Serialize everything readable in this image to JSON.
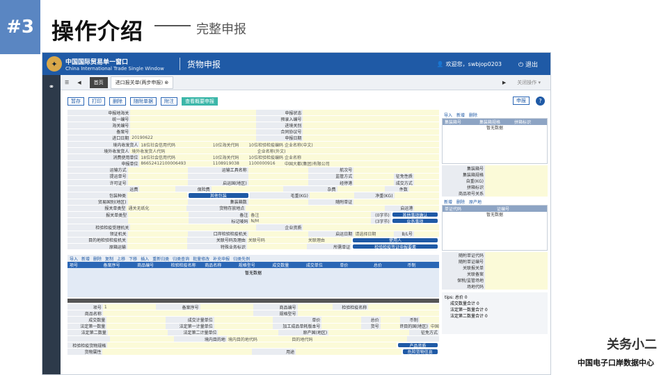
{
  "slide": {
    "badge": "#3",
    "title": "操作介绍",
    "dash": "——",
    "subtitle": "完整申报"
  },
  "header": {
    "brand_zh": "中国国际贸易单一窗口",
    "brand_en": "China International Trade Single Window",
    "module": "货物申报",
    "welcome": "欢迎您，swbjop0203",
    "logout": "退出"
  },
  "tabs": {
    "home": "首页",
    "active": "进口报关单(两步申报)",
    "close_ops": "关闭操作 ▾"
  },
  "toolbar": {
    "buttons": [
      "暂存",
      "打印",
      "删除",
      "随附单据",
      "附注",
      "查看概要申报"
    ],
    "declare": "申报",
    "help": "?"
  },
  "form": {
    "rows": [
      [
        [
          "lbl",
          "申报地海关",
          1.2
        ],
        [
          "val",
          "",
          2.4
        ],
        [
          "lbl",
          "申报状态",
          0.9
        ],
        [
          "val",
          "",
          2.6
        ]
      ],
      [
        [
          "lbl",
          "统一编号",
          1.2
        ],
        [
          "val",
          "",
          2.4
        ],
        [
          "lbl",
          "预录入编号",
          0.9
        ],
        [
          "val",
          "",
          2.6
        ]
      ],
      [
        [
          "lbl",
          "海关编号",
          1.2
        ],
        [
          "val",
          "",
          2.4
        ],
        [
          "lbl",
          "进境关别",
          0.9
        ],
        [
          "val",
          "",
          2.6
        ]
      ],
      [
        [
          "lbl",
          "备案号",
          1.2
        ],
        [
          "val",
          "",
          2.4
        ],
        [
          "lbl",
          "合同协议号",
          0.9
        ],
        [
          "val",
          "",
          2.6
        ]
      ],
      [
        [
          "lbl",
          "进口日期",
          1.2
        ],
        [
          "val",
          "20190622",
          2.4
        ],
        [
          "lbl",
          "申报日期",
          0.9
        ],
        [
          "val",
          "",
          2.6
        ]
      ],
      [
        [
          "lbl",
          "境内收发货人",
          1.2
        ],
        [
          "val",
          "18位社会信用代码",
          1.2
        ],
        [
          "val",
          "10位海关代码",
          0.6
        ],
        [
          "val",
          "10位检验检疫编码",
          0.6
        ],
        [
          "val",
          "企业名称(中文)",
          2.6
        ]
      ],
      [
        [
          "lbl",
          "境外收发货人",
          1.2
        ],
        [
          "val",
          "境外收发货人代码",
          2.4
        ],
        [
          "val",
          "企业名称(外文)",
          3.5
        ]
      ],
      [
        [
          "lbl",
          "消费使用单位",
          1.2
        ],
        [
          "val",
          "18位社会信用代码",
          1.2
        ],
        [
          "val",
          "10位海关代码",
          0.6
        ],
        [
          "val",
          "10位检验检疫编码",
          0.6
        ],
        [
          "val",
          "企业名称",
          2.6
        ]
      ],
      [
        [
          "lbl",
          "申报单位",
          1.2
        ],
        [
          "val",
          "86652412100006493",
          1.2
        ],
        [
          "val",
          "1108919038",
          0.6
        ],
        [
          "val",
          "1100000916",
          0.6
        ],
        [
          "val",
          "中国大都(集团)有限公司",
          2.6
        ]
      ],
      [
        [
          "lbl",
          "运输方式",
          1.2
        ],
        [
          "val",
          "",
          1.2
        ],
        [
          "lbl",
          "运输工具名称",
          1.2
        ],
        [
          "val",
          "",
          1.2
        ],
        [
          "lbl",
          "航次号",
          0.9
        ],
        [
          "val",
          "",
          1.7
        ]
      ],
      [
        [
          "lbl",
          "提运单号",
          1.2
        ],
        [
          "val",
          "",
          1.2
        ],
        [
          "lbl",
          "",
          1.2
        ],
        [
          "val",
          "",
          1.2
        ],
        [
          "lbl",
          "监管方式",
          0.9
        ],
        [
          "val",
          "",
          0.8
        ],
        [
          "lbl",
          "征免性质",
          0.4
        ],
        [
          "val",
          "",
          0.5
        ]
      ],
      [
        [
          "lbl",
          "许可证号",
          1.2
        ],
        [
          "val",
          "",
          1.2
        ],
        [
          "lbl",
          "启运国(地区)",
          1.2
        ],
        [
          "val",
          "",
          1.2
        ],
        [
          "lbl",
          "经停港",
          0.9
        ],
        [
          "val",
          "",
          0.8
        ],
        [
          "lbl",
          "成交方式",
          0.4
        ],
        [
          "val",
          "",
          0.5
        ]
      ],
      [
        [
          "lbl",
          "运费",
          1.2
        ],
        [
          "val",
          "",
          0.6
        ],
        [
          "lbl",
          "保险费",
          0.6
        ],
        [
          "val",
          "",
          1.2
        ],
        [
          "lbl",
          "杂费",
          0.9
        ],
        [
          "val",
          "",
          0.8
        ],
        [
          "lbl",
          "件数",
          0.4
        ],
        [
          "val",
          "",
          0.5
        ]
      ],
      [
        [
          "lbl",
          "包装种类",
          1.2
        ],
        [
          "val",
          "",
          1.2
        ],
        [
          "blueb",
          "其他包装",
          1.2
        ],
        [
          "lbl",
          "毛重(KG)",
          1.2
        ],
        [
          "val",
          "",
          0.9
        ],
        [
          "lbl",
          "净重(KG)",
          0.8
        ],
        [
          "val",
          "",
          0.9
        ]
      ],
      [
        [
          "lbl",
          "贸易国别(地区)",
          1.2
        ],
        [
          "val",
          "",
          1.2
        ],
        [
          "lbl",
          "集装箱数",
          1.2
        ],
        [
          "val",
          "",
          1.2
        ],
        [
          "lbl",
          "随附单证",
          0.9
        ],
        [
          "val",
          "",
          1.7
        ]
      ],
      [
        [
          "lbl",
          "报关单类型",
          1.2
        ],
        [
          "val",
          "通关无纸化",
          1.2
        ],
        [
          "lbl",
          "货物存放地点",
          1.2
        ],
        [
          "val",
          "",
          2.8
        ],
        [
          "lbl",
          "启运港",
          0.6
        ],
        [
          "val",
          "",
          0.5
        ]
      ],
      [
        [
          "lbl",
          "报关单类型",
          1.2
        ],
        [
          "val",
          "",
          1.2
        ],
        [
          "lbl",
          "备注",
          1.2
        ],
        [
          "val",
          "备注",
          2.4
        ],
        [
          "lbl",
          "(0字节)",
          0.4
        ],
        [
          "blueb",
          "其他事项确认",
          0.9
        ]
      ],
      [
        [
          "lbl",
          "",
          1.2
        ],
        [
          "val",
          "",
          1.2
        ],
        [
          "lbl",
          "标记唛码",
          1.2
        ],
        [
          "val",
          "N/M",
          2.4
        ],
        [
          "lbl",
          "(3字节)",
          0.4
        ],
        [
          "blueb",
          "业务事项",
          0.9
        ]
      ],
      [
        [
          "lbl",
          "检验检疫受理机关",
          1.2
        ],
        [
          "val",
          "",
          2.4
        ],
        [
          "lbl",
          "企业资质",
          0.9
        ],
        [
          "val",
          "",
          2.6
        ]
      ],
      [
        [
          "lbl",
          "领证机关",
          1.2
        ],
        [
          "val",
          "",
          1.2
        ],
        [
          "lbl",
          "口岸检验检疫机关",
          1.2
        ],
        [
          "val",
          "",
          1.2
        ],
        [
          "lbl",
          "启运日期",
          0.9
        ],
        [
          "val",
          "请选择日期",
          0.8
        ],
        [
          "lbl",
          "B/L号",
          0.4
        ],
        [
          "val",
          "",
          0.5
        ]
      ],
      [
        [
          "lbl",
          "目的地检验检疫机关",
          1.2
        ],
        [
          "val",
          "",
          1.2
        ],
        [
          "lbl",
          "关联号码及理由",
          1.2
        ],
        [
          "val",
          "关联号码",
          1.2
        ],
        [
          "val",
          "关联理由",
          0.9
        ],
        [
          "blueb",
          "使用人",
          1.7
        ]
      ],
      [
        [
          "lbl",
          "原箱运输",
          1.2
        ],
        [
          "val",
          "",
          1.2
        ],
        [
          "lbl",
          "特殊业务标识",
          1.2
        ],
        [
          "val",
          "",
          1.2
        ],
        [
          "lbl",
          "所需单证",
          0.9
        ],
        [
          "blueb",
          "检验检疫签证申报要素",
          1.7
        ]
      ]
    ]
  },
  "goods_bar": [
    "导入",
    "新增",
    "删除",
    "复制",
    "上移",
    "下移",
    "插入",
    "重新归类",
    "归类查询",
    "批量修改",
    "补充申报",
    "归类先例"
  ],
  "goods_columns": [
    "项号",
    "备案序号",
    "商品编号",
    "检验检疫名称",
    "商品名称",
    "规格型号",
    "成交数量",
    "成交单位",
    "单价",
    "总价",
    "币制"
  ],
  "goods_empty": "暂无数据",
  "bottom": {
    "rows": [
      [
        [
          "lbl",
          "项号",
          0.8
        ],
        [
          "val",
          "1",
          1.2
        ],
        [
          "lbl",
          "备案序号",
          1.0
        ],
        [
          "val",
          "",
          1.2
        ],
        [
          "lbl",
          "商品编号",
          1.0
        ],
        [
          "val",
          "",
          0.8
        ],
        [
          "lbl",
          "检验检疫名称",
          0.8
        ],
        [
          "val",
          "",
          1.6
        ]
      ],
      [
        [
          "lbl",
          "商品名称",
          0.8
        ],
        [
          "val",
          "",
          3.4
        ],
        [
          "lbl",
          "规格型号",
          1.0
        ],
        [
          "val",
          "",
          3.2
        ]
      ],
      [
        [
          "lbl",
          "成交数量",
          0.8
        ],
        [
          "val",
          "",
          1.2
        ],
        [
          "lbl",
          "成交计量单位",
          1.0
        ],
        [
          "val",
          "",
          1.2
        ],
        [
          "lbl",
          "单价",
          1.0
        ],
        [
          "val",
          "",
          0.8
        ],
        [
          "lbl",
          "总价",
          0.4
        ],
        [
          "val",
          "",
          0.4
        ],
        [
          "lbl",
          "币制",
          0.4
        ],
        [
          "val",
          "",
          0.4
        ]
      ],
      [
        [
          "lbl",
          "法定第一数量",
          0.8
        ],
        [
          "val",
          "",
          1.2
        ],
        [
          "lbl",
          "法定第一计量单位",
          1.0
        ],
        [
          "val",
          "",
          1.2
        ],
        [
          "lbl",
          "加工成品单耗版本号",
          1.0
        ],
        [
          "val",
          "",
          0.8
        ],
        [
          "lbl",
          "货号",
          0.4
        ],
        [
          "val",
          "",
          0.4
        ],
        [
          "lbl",
          "最终目的国(地区)",
          0.6
        ],
        [
          "val",
          "中国",
          0.2
        ]
      ],
      [
        [
          "lbl",
          "法定第二数量",
          0.8
        ],
        [
          "val",
          "",
          1.2
        ],
        [
          "lbl",
          "法定第二计量单位",
          1.0
        ],
        [
          "val",
          "",
          1.2
        ],
        [
          "lbl",
          "原产国(地区)",
          1.0
        ],
        [
          "val",
          "",
          1.6
        ],
        [
          "lbl",
          "征免方式",
          0.6
        ]
      ],
      [
        [
          "lbl",
          "",
          0.8
        ],
        [
          "val",
          "",
          1.2
        ],
        [
          "lbl",
          "境内目的地",
          1.0
        ],
        [
          "val",
          "境内目的地代码",
          1.2
        ],
        [
          "val",
          "目的地代码",
          2.2
        ],
        [
          "lbl",
          "",
          0.6
        ]
      ],
      [
        [
          "lbl",
          "检验检疫货物规格",
          0.8
        ],
        [
          "val",
          "",
          5.8
        ],
        [
          "blueb",
          "产品资质",
          0.8
        ]
      ],
      [
        [
          "lbl",
          "货物属性",
          0.8
        ],
        [
          "val",
          "",
          3.4
        ],
        [
          "lbl",
          "用途",
          1.0
        ],
        [
          "val",
          "",
          2.4
        ],
        [
          "blueb",
          "危险货物信息",
          0.8
        ]
      ]
    ]
  },
  "right": {
    "top_bar": [
      "导入",
      "新增",
      "删除"
    ],
    "top_cols": [
      "集装箱号",
      "集装箱规格",
      "拼箱标识"
    ],
    "empty": "暂无数据",
    "fields1": [
      "集装箱号",
      "集装箱规格",
      "自重(KG)",
      "拼箱标识",
      "商品项号关系"
    ],
    "bar2": [
      "新增",
      "删除",
      "原产地"
    ],
    "cols2": [
      "单证代码",
      "证编号"
    ],
    "empty2": "暂无数据",
    "fields2": [
      "随附单证代码",
      "随附单证编号",
      "关联报关单",
      "关联备案",
      "保税/监管场地",
      "场地代码"
    ],
    "tips": "tips: 总价 0",
    "sum": [
      "成交数量合计 0",
      "法定第一数量合计 0",
      "法定第二数量合计 0"
    ]
  },
  "watermark": {
    "brand": "关务小二",
    "org": "中国电子口岸数据中心"
  }
}
